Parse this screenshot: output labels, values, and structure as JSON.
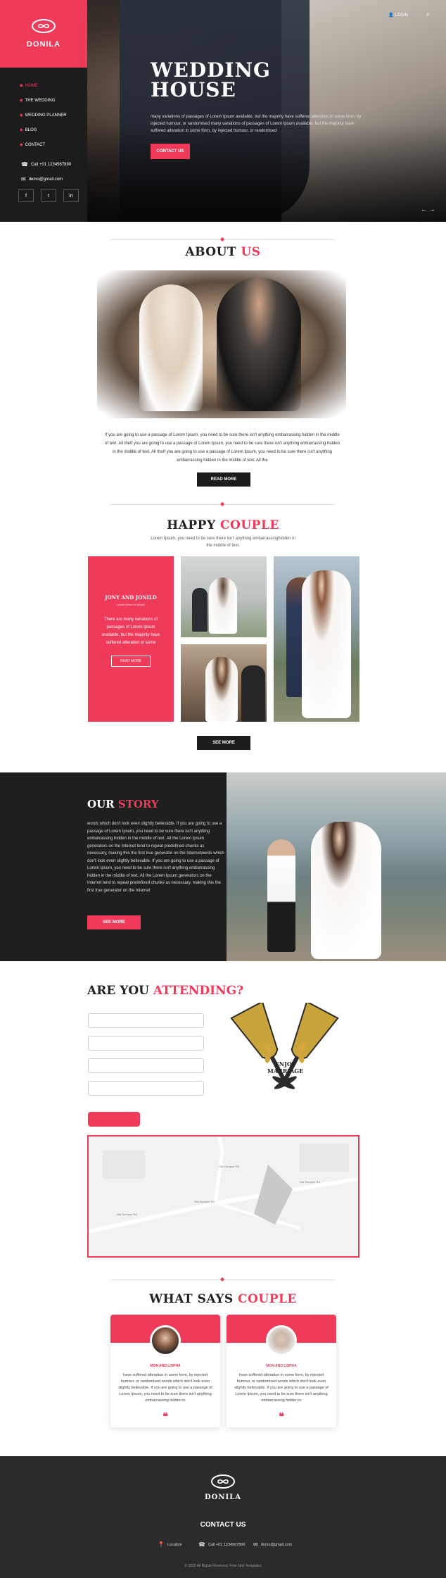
{
  "brand": {
    "logo_text": "DONILA",
    "accent": "#f03a5a",
    "dark": "#1c1c1c"
  },
  "header": {
    "login_label": "LOGIN",
    "search_icon": "search-icon"
  },
  "nav": {
    "items": [
      "HOME",
      "THE WEDDING",
      "WEDDING PLANNER",
      "BLOG",
      "CONTACT"
    ],
    "active_index": 0
  },
  "sidebar_contact": {
    "phone": "Call +01 1234567890",
    "email": "demo@gmail.com"
  },
  "socials": [
    "f",
    "t",
    "in"
  ],
  "hero": {
    "title_line1": "WEDDING",
    "title_line2": "HOUSE",
    "text": "many variations of passages of Lorem Ipsum available, but the majority have suffered alteration in some form, by injected humour, or randomised many variations of passages of Lorem Ipsum available, but the majority have suffered alteration in some form, by injected humour, or randomised",
    "button": "CONTACT US",
    "arrows": "← →"
  },
  "about": {
    "title_a": "ABOUT",
    "title_b": "US",
    "text": "If you are going to use a passage of Lorem Ipsum, you need to be sure there isn't anything embarrassing hidden in the middle of text. All theIf you are going to use a passage of Lorem Ipsum, you need to be sure there isn't anything embarrassing hidden in the middle of text. All theIf you are going to use a passage of Lorem Ipsum, you need to be sure there isn't anything embarrassing hidden in the middle of text. All the",
    "button": "READ MORE"
  },
  "happy_couple": {
    "title_a": "HAPPY",
    "title_b": "COUPLE",
    "subtitle": "Lorem Ipsum, you need to be sure there isn't anything embarrassinghidden in the middle of text.",
    "card_title": "JONY AND JONILD",
    "card_sub": "Lorem Ipsum is simply",
    "card_text": "There are many variations of passages of Lorem Ipsum available, but the majority have suffered alteration in some",
    "card_button": "READ MORE",
    "button": "SEE MORE"
  },
  "story": {
    "title_a": "OUR",
    "title_b": "STORY",
    "text": "words which don't look even slightly believable. If you are going to use a passage of Lorem Ipsum, you need to be sure there isn't anything embarrassing hidden in the middle of text. All the Lorem Ipsum generators on the Internet tend to repeat predefined chunks as necessary, making this the first true generator on the Internetwords which don't look even slightly believable. If you are going to use a passage of Lorem Ipsum, you need to be sure there isn't anything embarrassing hidden in the middle of text. All the Lorem Ipsum generators on the Internet tend to repeat predefined chunks as necessary, making this the first true generator on the Internet",
    "button": "SEE MORE"
  },
  "attending": {
    "title_a": "ARE YOU",
    "title_b": "ATTENDING?",
    "fields": [
      "",
      "",
      "",
      ""
    ],
    "graphic_text_1": "ENJOY",
    "graphic_text_2": "MARRIAGE",
    "map_labels": [
      "Old Sonapur Rd",
      "Old Sonapur Rd",
      "Old Sonapur Rd",
      "Old Sonapur Rd"
    ]
  },
  "testimonials": {
    "title_a": "WHAT SAYS",
    "title_b": "COUPLE",
    "items": [
      {
        "name": "MON AND LISPHA",
        "text": "have suffered alteration in some form, by injected humour, or randomised words which don't look even slightly believable. If you are going to use a passage of Lorem Ipsum, you need to be sure there isn't anything embarrassing hidden in",
        "quote": "❝"
      },
      {
        "name": "MON AND LISPHA",
        "text": "have suffered alteration in some form, by injected humour, or randomised words which don't look even slightly believable. If you are going to use a passage of Lorem Ipsum, you need to be sure there isn't anything embarrassing hidden in",
        "quote": "❝"
      }
    ]
  },
  "footer": {
    "logo_text": "DONILA",
    "contact_title": "CONTACT US",
    "location": "Location",
    "phone": "Call +01 1234567890",
    "email": "demo@gmail.com",
    "copyright": "© 2020 All Rights Reserved. Free html Templates"
  }
}
